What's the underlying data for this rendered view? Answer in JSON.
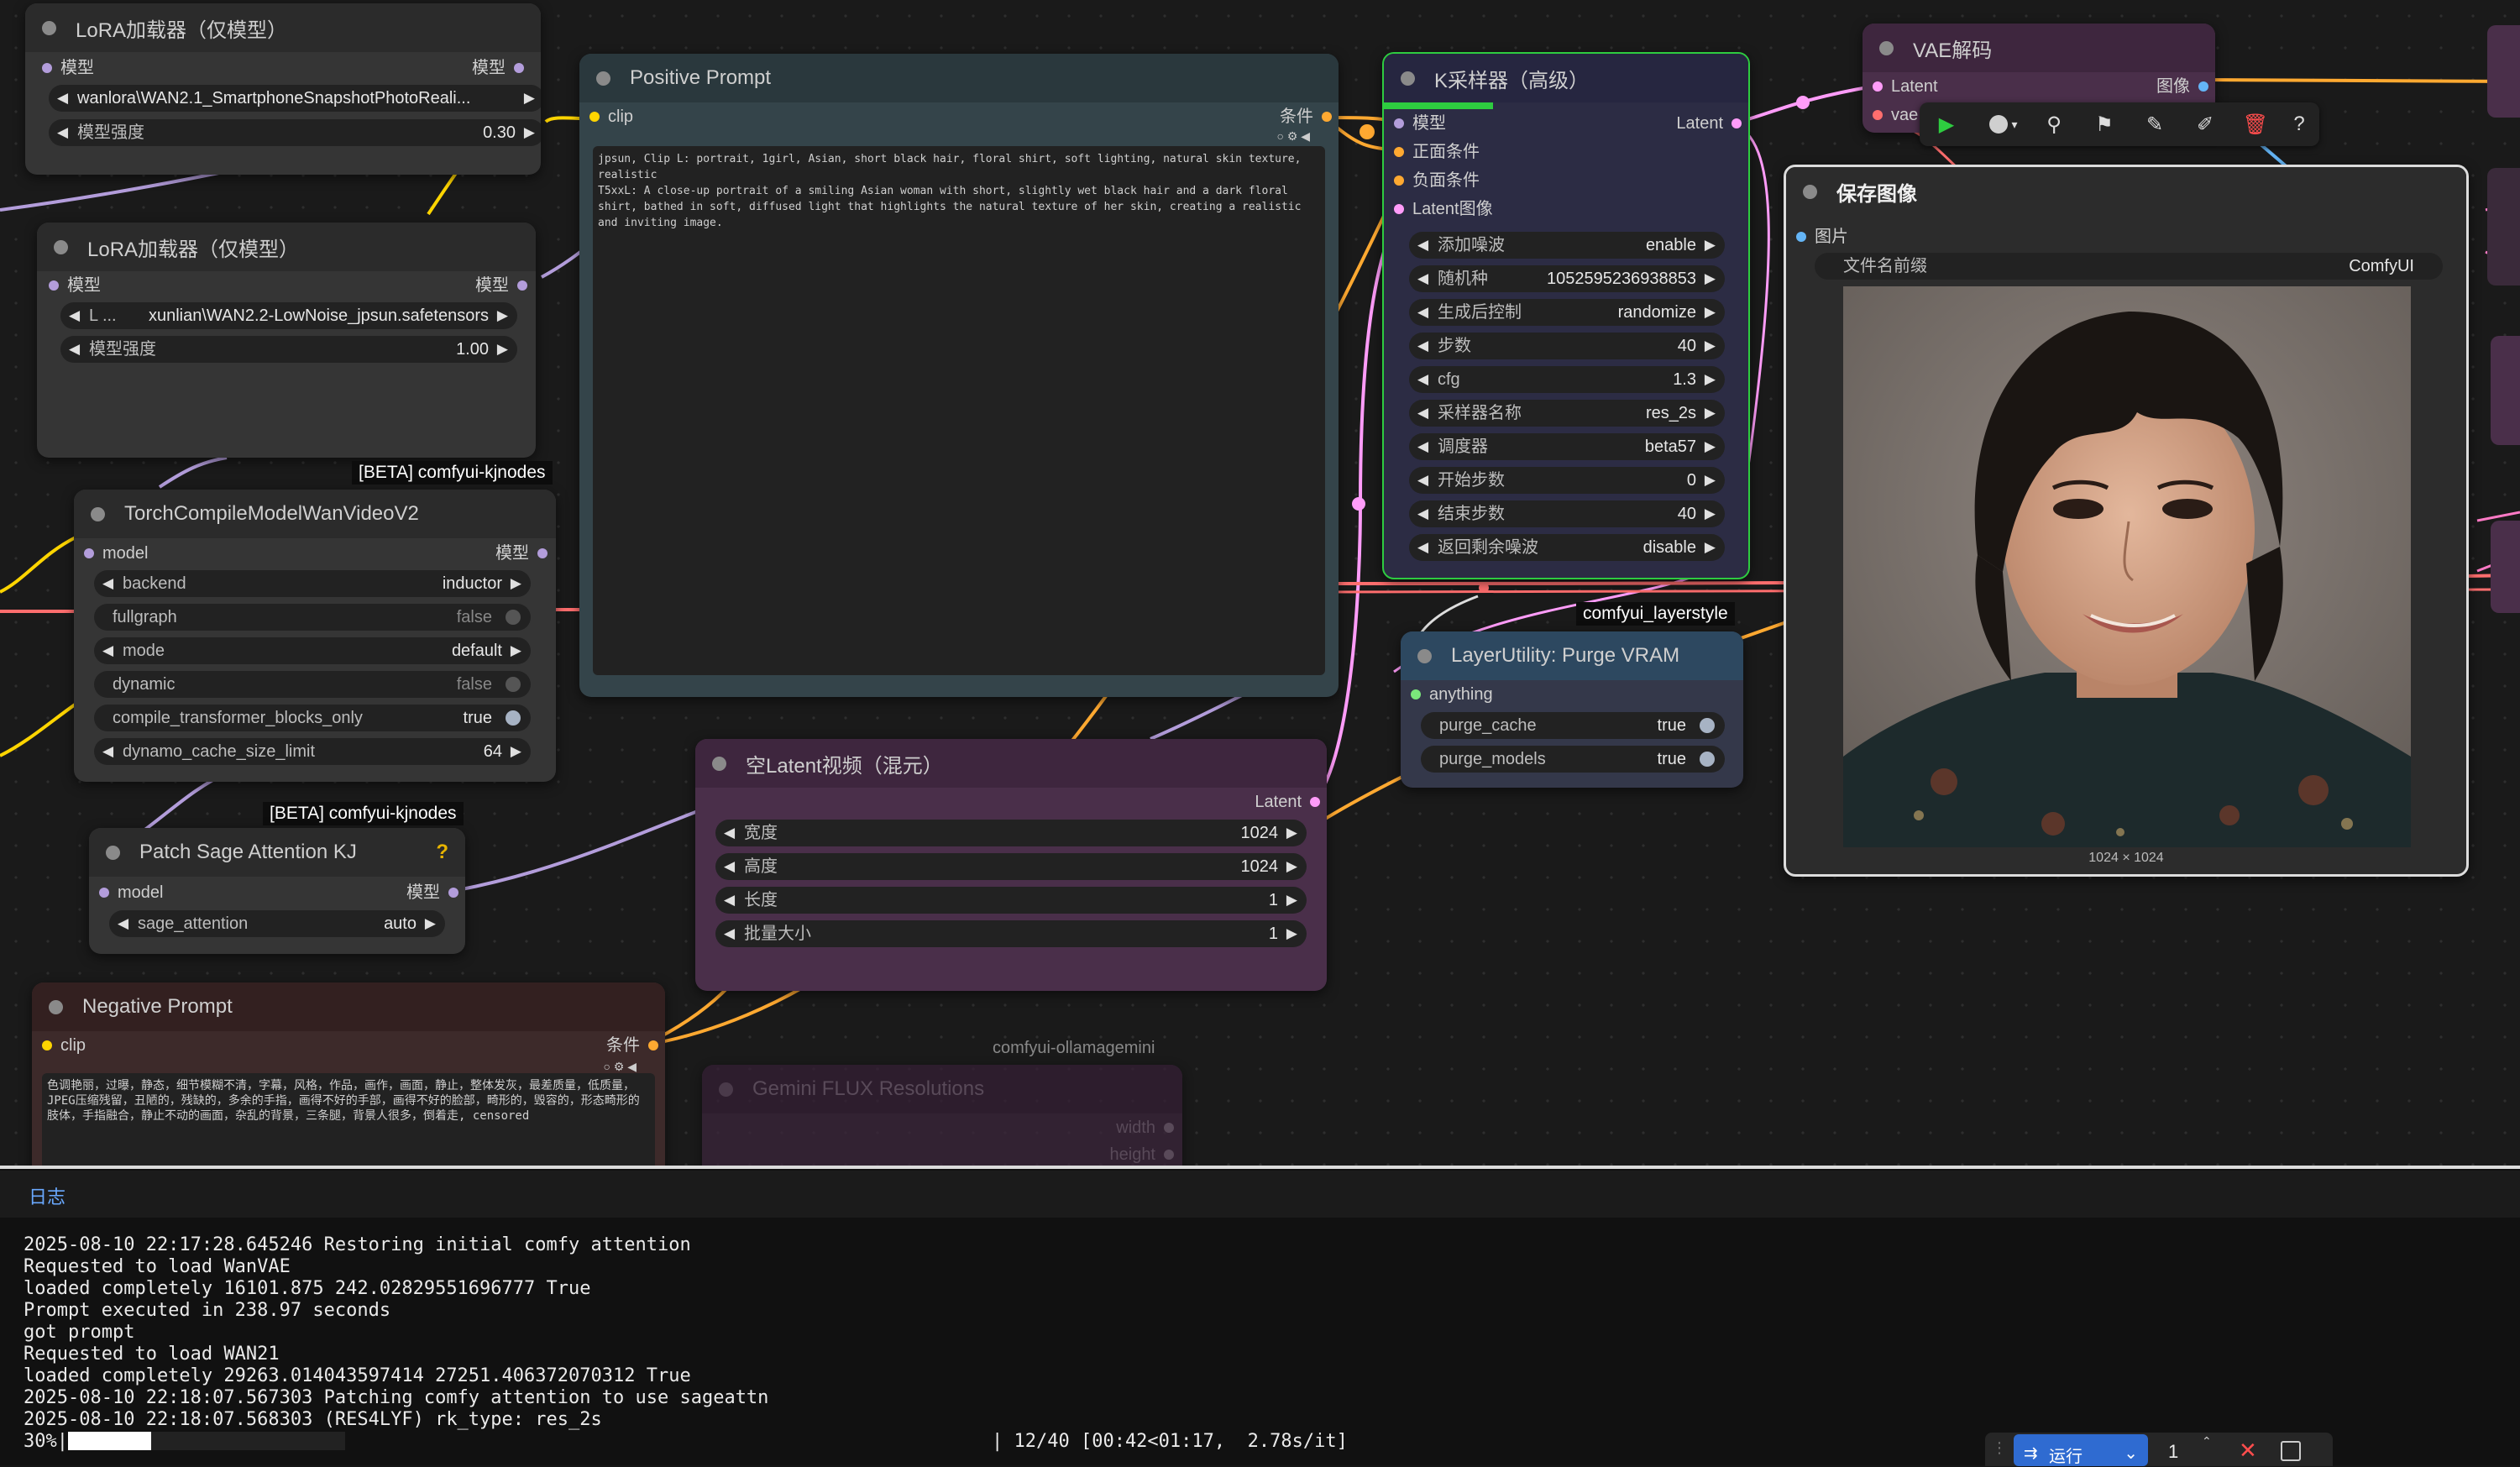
{
  "nodes": {
    "lora1": {
      "title": "LoRA加载器（仅模型）",
      "in_label": "模型",
      "out_label": "模型",
      "lora_name": "wanlora\\WAN2.1_SmartphoneSnapshotPhotoReali...",
      "strength_label": "模型强度",
      "strength": "0.30"
    },
    "lora2": {
      "title": "LoRA加载器（仅模型）",
      "in_label": "模型",
      "out_label": "模型",
      "lora_prefix": "L ...",
      "lora_name": "xunlian\\WAN2.2-LowNoise_jpsun.safetensors",
      "strength_label": "模型强度",
      "strength": "1.00"
    },
    "kj_tag1": "[BETA] comfyui-kjnodes",
    "torch": {
      "title": "TorchCompileModelWanVideoV2",
      "in_label": "model",
      "out_label": "模型",
      "widgets": [
        {
          "label": "backend",
          "value": "inductor"
        },
        {
          "label": "fullgraph",
          "value": "false"
        },
        {
          "label": "mode",
          "value": "default"
        },
        {
          "label": "dynamic",
          "value": "false"
        },
        {
          "label": "compile_transformer_blocks_only",
          "value": "true"
        },
        {
          "label": "dynamo_cache_size_limit",
          "value": "64"
        }
      ]
    },
    "kj_tag2": "[BETA] comfyui-kjnodes",
    "sage": {
      "title": "Patch Sage Attention KJ",
      "badge": "?",
      "in_label": "model",
      "out_label": "模型",
      "widget_label": "sage_attention",
      "widget_value": "auto"
    },
    "negative": {
      "title": "Negative Prompt",
      "in_label": "clip",
      "out_label": "条件",
      "text": "色调艳丽，过曝，静态，细节模糊不清，字幕，风格，作品，画作，画面，静止，整体发灰，最差质量，低质量，JPEG压缩残留，丑陋的，残缺的，多余的手指，画得不好的手部，画得不好的脸部，畸形的，毁容的，形态畸形的肢体，手指融合，静止不动的画面，杂乱的背景，三条腿，背景人很多，倒着走, censored"
    },
    "positive": {
      "title": "Positive Prompt",
      "in_label": "clip",
      "out_label": "条件",
      "text": "jpsun, Clip L: portrait, 1girl, Asian, short black hair, floral shirt, soft lighting, natural skin texture, realistic\nT5xxL: A close-up portrait of a smiling Asian woman with short, slightly wet black hair and a dark floral shirt, bathed in soft, diffused light that highlights the natural texture of her skin, creating a realistic and inviting image."
    },
    "latent": {
      "title": "空Latent视频（混元）",
      "out_label": "Latent",
      "widgets": [
        {
          "label": "宽度",
          "value": "1024"
        },
        {
          "label": "高度",
          "value": "1024"
        },
        {
          "label": "长度",
          "value": "1"
        },
        {
          "label": "批量大小",
          "value": "1"
        }
      ]
    },
    "ollama_tag": "comfyui-ollamagemini",
    "gemini": {
      "title": "Gemini FLUX Resolutions",
      "out1": "width",
      "out2": "height"
    },
    "ksampler": {
      "title": "K采样器（高级）",
      "inputs": [
        "模型",
        "正面条件",
        "负面条件",
        "Latent图像"
      ],
      "out_label": "Latent",
      "widgets": [
        {
          "label": "添加噪波",
          "value": "enable"
        },
        {
          "label": "随机种",
          "value": "1052595236938853"
        },
        {
          "label": "生成后控制",
          "value": "randomize"
        },
        {
          "label": "步数",
          "value": "40"
        },
        {
          "label": "cfg",
          "value": "1.3"
        },
        {
          "label": "采样器名称",
          "value": "res_2s"
        },
        {
          "label": "调度器",
          "value": "beta57"
        },
        {
          "label": "开始步数",
          "value": "0"
        },
        {
          "label": "结束步数",
          "value": "40"
        },
        {
          "label": "返回剩余噪波",
          "value": "disable"
        }
      ]
    },
    "layer_tag": "comfyui_layerstyle",
    "purge": {
      "title": "LayerUtility: Purge VRAM",
      "in_label": "anything",
      "widgets": [
        {
          "label": "purge_cache",
          "value": "true"
        },
        {
          "label": "purge_models",
          "value": "true"
        }
      ]
    },
    "vae": {
      "title": "VAE解码",
      "in1": "Latent",
      "in2": "vae",
      "out_label": "图像"
    },
    "save": {
      "title": "保存图像",
      "in_label": "图片",
      "prefix_label": "文件名前缀",
      "prefix_value": "ComfyUI",
      "image_size": "1024 × 1024"
    }
  },
  "log": {
    "tab": "日志",
    "lines": [
      "2025-08-10 22:17:28.645246 Restoring initial comfy attention",
      "Requested to load WanVAE",
      "loaded completely 16101.875 242.02829551696777 True",
      "Prompt executed in 238.97 seconds",
      "got prompt",
      "Requested to load WAN21",
      "loaded completely 29263.014043597414 27251.406372070312 True",
      "2025-08-10 22:18:07.567303 Patching comfy attention to use sageattn",
      "2025-08-10 22:18:07.568303 (RES4LYF) rk_type: res_2s"
    ],
    "progress_pct": "30%",
    "progress_fraction": 0.3,
    "progress_stats": "| 12/40 [00:42<01:17,  2.78s/it]"
  },
  "run_bar": {
    "run_label": "运行",
    "count": "1"
  },
  "colors": {
    "model": "#b39ddb",
    "clip": "#ffd500",
    "conditioning": "#ffa931",
    "latent": "#ff9cf9",
    "image": "#64b5f6",
    "vae": "#ff6e6e",
    "accent_green": "#2ecc40"
  }
}
